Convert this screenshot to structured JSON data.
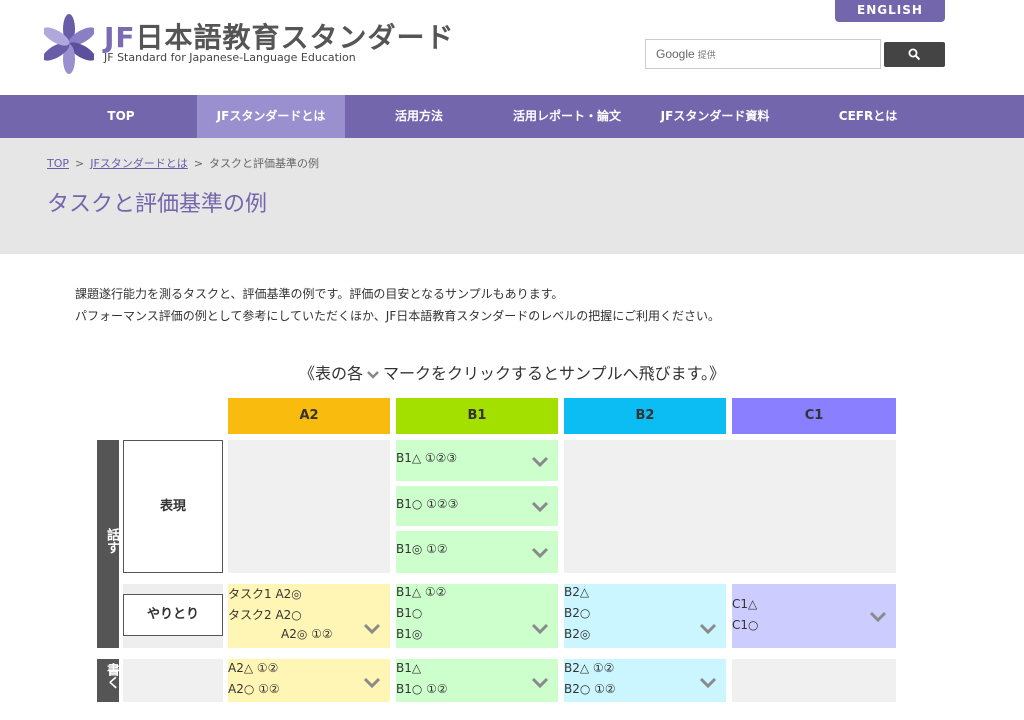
{
  "header": {
    "title_prefix": "JF",
    "title_main": "日本語教育スタンダード",
    "subtitle": "JF Standard for Japanese-Language Education",
    "english_label": "ENGLISH",
    "search_brand": "Google",
    "search_provided": "提供"
  },
  "nav": {
    "items": [
      "TOP",
      "JFスタンダードとは",
      "活用方法",
      "活用レポート・論文",
      "JFスタンダード資料",
      "CEFRとは"
    ]
  },
  "breadcrumb": {
    "items": [
      "TOP",
      "JFスタンダードとは",
      "タスクと評価基準の例"
    ]
  },
  "page": {
    "title": "タスクと評価基準の例",
    "intro_1": "課題遂行能力を測るタスクと、評価基準の例です。評価の目安となるサンプルもあります。",
    "intro_2": "パフォーマンス評価の例として参考にしていただくほか、JF日本語教育スタンダードのレベルの把握にご利用ください。",
    "notice_before": "《表の各",
    "notice_after": "マークをクリックするとサンプルへ飛びます。》"
  },
  "table": {
    "levels": [
      "A2",
      "B1",
      "B2",
      "C1"
    ],
    "rows": {
      "speak": "話す",
      "write": "書く",
      "expression": "表現",
      "interaction": "やりとり"
    },
    "cells": {
      "expr_b1": [
        "B1△ ①②③",
        "B1○ ①②③",
        "B1◎ ①②"
      ],
      "inter_a2": [
        "タスク1 A2◎",
        "タスク2 A2○",
        "A2◎ ①②"
      ],
      "inter_b1": [
        "B1△ ①②",
        "B1○",
        "B1◎"
      ],
      "inter_b2": [
        "B2△",
        "B2○",
        "B2◎"
      ],
      "inter_c1": [
        "C1△",
        "C1○"
      ],
      "write_a2": [
        "A2△ ①②",
        "A2○ ①②"
      ],
      "write_b1": [
        "B1△",
        "B1○ ①②"
      ],
      "write_b2": [
        "B2△ ①②",
        "B2○ ①②"
      ]
    }
  },
  "colors": {
    "brand": "#7466ad",
    "a2": "#f9bc0e",
    "b1": "#a3e000",
    "b2": "#0cbdf4",
    "c1": "#8a80ff"
  }
}
